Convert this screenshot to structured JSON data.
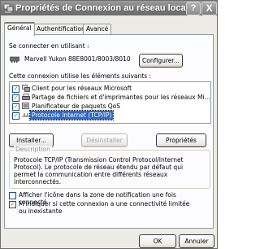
{
  "window": {
    "title": "Propriétés de Connexion au réseau local",
    "help": "?",
    "close": "X"
  },
  "tabs": [
    {
      "label": "Général",
      "active": true
    },
    {
      "label": "Authentification",
      "active": false
    },
    {
      "label": "Avancé",
      "active": false
    }
  ],
  "connect_using": {
    "label": "Se connecter en utilisant :",
    "adapter": "Marvell Yukon 88E8001/8003/8010",
    "configure_button": "Configurer..."
  },
  "items_section": {
    "label": "Cette connexion utilise les éléments suivants :",
    "items": [
      {
        "label": "Client pour les réseaux Microsoft",
        "checked": true,
        "icon": "network-client-icon"
      },
      {
        "label": "Partage de fichiers et d'imprimantes pour les réseaux Mi...",
        "checked": true,
        "icon": "printer-share-icon"
      },
      {
        "label": "Planificateur de paquets QoS",
        "checked": true,
        "icon": "qos-scheduler-icon"
      },
      {
        "label": "Protocole Internet (TCP/IP)",
        "checked": true,
        "icon": "protocol-icon",
        "selected": true
      }
    ]
  },
  "buttons": {
    "install": "Installer...",
    "uninstall": "Désinstaller",
    "properties": "Propriétés",
    "ok": "OK",
    "cancel": "Annuler"
  },
  "description": {
    "title": "Description",
    "lines": [
      "Protocole TCP/IP (Transmission Control Protocol/Internet",
      "Protocol). Le protocole de réseau étendu par défaut qui",
      "permet la communication entre différents réseaux",
      "interconnectés."
    ]
  },
  "options": [
    {
      "label": "Afficher l'icône dans la zone de notification une fois connecté",
      "checked": false
    },
    {
      "label": "M'indiquer si cette connexion a une connectivité limitée ou inexistante",
      "checked": true
    }
  ]
}
